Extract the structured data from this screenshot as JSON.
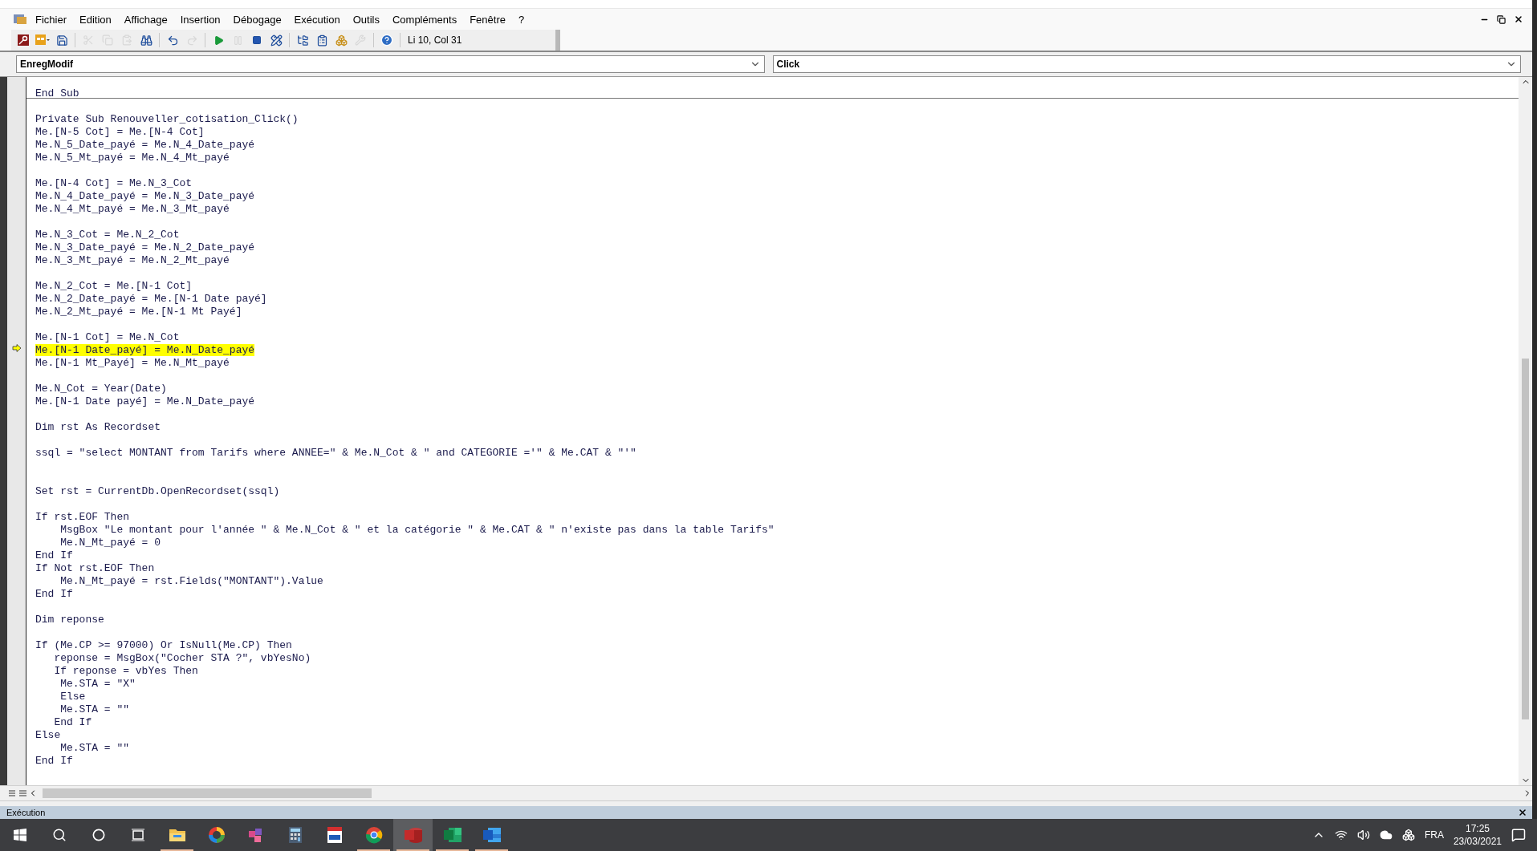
{
  "menu": {
    "items": [
      "Fichier",
      "Edition",
      "Affichage",
      "Insertion",
      "Débogage",
      "Exécution",
      "Outils",
      "Compléments",
      "Fenêtre",
      "?"
    ]
  },
  "toolbar": {
    "groups": [
      [
        {
          "kind": "access",
          "disabled": false
        },
        {
          "kind": "insert",
          "disabled": false
        },
        {
          "kind": "save",
          "disabled": false
        }
      ],
      [
        {
          "kind": "cut",
          "disabled": true
        },
        {
          "kind": "copy",
          "disabled": true
        },
        {
          "kind": "paste",
          "disabled": true
        },
        {
          "kind": "find",
          "disabled": false
        }
      ],
      [
        {
          "kind": "undo",
          "disabled": false
        },
        {
          "kind": "redo",
          "disabled": true
        }
      ],
      [
        {
          "kind": "run",
          "disabled": false
        },
        {
          "kind": "pause",
          "disabled": true
        },
        {
          "kind": "reset",
          "disabled": false
        },
        {
          "kind": "design",
          "disabled": false
        }
      ],
      [
        {
          "kind": "project",
          "disabled": false
        },
        {
          "kind": "properties",
          "disabled": false
        },
        {
          "kind": "browser",
          "disabled": false
        },
        {
          "kind": "toolbox",
          "disabled": true
        }
      ],
      [
        {
          "kind": "help",
          "disabled": false
        }
      ]
    ],
    "position": "Li 10, Col 31"
  },
  "editor": {
    "object_combo": "EnregModif",
    "procedure_combo": "Click",
    "procedures": [
      {
        "lines": [
          {
            "kind": "code",
            "text": "End Sub",
            "current": false
          }
        ]
      },
      {
        "lines": [
          {
            "kind": "blank"
          },
          {
            "kind": "code",
            "text": "Private Sub Renouveller_cotisation_Click()",
            "current": false
          },
          {
            "kind": "code",
            "text": "Me.[N-5 Cot] = Me.[N-4 Cot]",
            "current": false
          },
          {
            "kind": "code",
            "text": "Me.N_5_Date_payé = Me.N_4_Date_payé",
            "current": false
          },
          {
            "kind": "code",
            "text": "Me.N_5_Mt_payé = Me.N_4_Mt_payé",
            "current": false
          },
          {
            "kind": "blank"
          },
          {
            "kind": "code",
            "text": "Me.[N-4 Cot] = Me.N_3_Cot",
            "current": false
          },
          {
            "kind": "code",
            "text": "Me.N_4_Date_payé = Me.N_3_Date_payé",
            "current": false
          },
          {
            "kind": "code",
            "text": "Me.N_4_Mt_payé = Me.N_3_Mt_payé",
            "current": false
          },
          {
            "kind": "blank"
          },
          {
            "kind": "code",
            "text": "Me.N_3_Cot = Me.N_2_Cot",
            "current": false
          },
          {
            "kind": "code",
            "text": "Me.N_3_Date_payé = Me.N_2_Date_payé",
            "current": false
          },
          {
            "kind": "code",
            "text": "Me.N_3_Mt_payé = Me.N_2_Mt_payé",
            "current": false
          },
          {
            "kind": "blank"
          },
          {
            "kind": "code",
            "text": "Me.N_2_Cot = Me.[N-1 Cot]",
            "current": false
          },
          {
            "kind": "code",
            "text": "Me.N_2_Date_payé = Me.[N-1 Date payé]",
            "current": false
          },
          {
            "kind": "code",
            "text": "Me.N_2_Mt_payé = Me.[N-1 Mt Payé]",
            "current": false
          },
          {
            "kind": "blank"
          },
          {
            "kind": "code",
            "text": "Me.[N-1 Cot] = Me.N_Cot",
            "current": false
          },
          {
            "kind": "code",
            "text": "Me.[N-1 Date_payé] = Me.N_Date_payé",
            "current": true
          },
          {
            "kind": "code",
            "text": "Me.[N-1 Mt_Payé] = Me.N_Mt_payé",
            "current": false
          },
          {
            "kind": "blank"
          },
          {
            "kind": "code",
            "text": "Me.N_Cot = Year(Date)",
            "current": false
          },
          {
            "kind": "code",
            "text": "Me.[N-1 Date payé] = Me.N_Date_payé",
            "current": false
          },
          {
            "kind": "blank"
          },
          {
            "kind": "code",
            "text": "Dim rst As Recordset",
            "current": false
          },
          {
            "kind": "blank"
          },
          {
            "kind": "code",
            "text": "ssql = \"select MONTANT from Tarifs where ANNEE=\" & Me.N_Cot & \" and CATEGORIE ='\" & Me.CAT & \"'\"",
            "current": false
          },
          {
            "kind": "blank"
          },
          {
            "kind": "blank"
          },
          {
            "kind": "code",
            "text": "Set rst = CurrentDb.OpenRecordset(ssql)",
            "current": false
          },
          {
            "kind": "blank"
          },
          {
            "kind": "code",
            "text": "If rst.EOF Then",
            "current": false
          },
          {
            "kind": "code",
            "text": "    MsgBox \"Le montant pour l'année \" & Me.N_Cot & \" et la catégorie \" & Me.CAT & \" n'existe pas dans la table Tarifs\"",
            "current": false
          },
          {
            "kind": "code",
            "text": "    Me.N_Mt_payé = 0",
            "current": false
          },
          {
            "kind": "code",
            "text": "End If",
            "current": false
          },
          {
            "kind": "code",
            "text": "If Not rst.EOF Then",
            "current": false
          },
          {
            "kind": "code",
            "text": "    Me.N_Mt_payé = rst.Fields(\"MONTANT\").Value",
            "current": false
          },
          {
            "kind": "code",
            "text": "End If",
            "current": false
          },
          {
            "kind": "blank"
          },
          {
            "kind": "code",
            "text": "Dim reponse",
            "current": false
          },
          {
            "kind": "blank"
          },
          {
            "kind": "code",
            "text": "If (Me.CP >= 97000) Or IsNull(Me.CP) Then",
            "current": false
          },
          {
            "kind": "code",
            "text": "   reponse = MsgBox(\"Cocher STA ?\", vbYesNo)",
            "current": false
          },
          {
            "kind": "code",
            "text": "   If reponse = vbYes Then",
            "current": false
          },
          {
            "kind": "code",
            "text": "    Me.STA = \"X\"",
            "current": false
          },
          {
            "kind": "code",
            "text": "    Else",
            "current": false
          },
          {
            "kind": "code",
            "text": "    Me.STA = \"\"",
            "current": false
          },
          {
            "kind": "code",
            "text": "   End If",
            "current": false
          },
          {
            "kind": "code",
            "text": "Else",
            "current": false
          },
          {
            "kind": "code",
            "text": "    Me.STA = \"\"",
            "current": false
          },
          {
            "kind": "code",
            "text": "End If",
            "current": false
          }
        ]
      }
    ]
  },
  "immediate_panel": {
    "title": "Exécution"
  },
  "taskbar": {
    "apps": [
      {
        "kind": "explorer",
        "running": true,
        "active": false
      },
      {
        "kind": "colorwheel",
        "running": false,
        "active": false
      },
      {
        "kind": "cubes",
        "running": false,
        "active": false
      },
      {
        "kind": "calculator",
        "running": false,
        "active": false
      },
      {
        "kind": "pdf",
        "running": false,
        "active": false
      },
      {
        "kind": "chrome",
        "running": true,
        "active": false
      },
      {
        "kind": "access",
        "running": true,
        "active": true
      },
      {
        "kind": "excel",
        "running": true,
        "active": false
      },
      {
        "kind": "word",
        "running": true,
        "active": false
      }
    ],
    "language": "FRA",
    "time": "17:25",
    "date": "23/03/2021"
  }
}
